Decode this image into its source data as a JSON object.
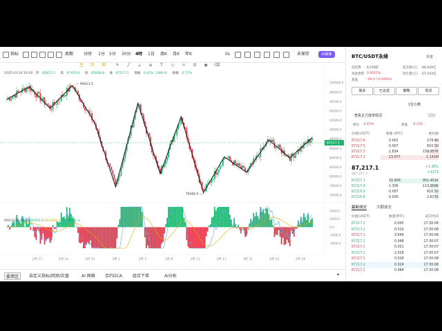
{
  "toolbar": {
    "icon_label": "指标",
    "chart_settings": "图表",
    "interval_group": "周期",
    "intervals": [
      "分时",
      "1分",
      "5分",
      "30分",
      "4时",
      "1日",
      "周K",
      "月K",
      "年K"
    ],
    "active_interval": "4时",
    "settings_label": "0s",
    "mode_label": "未保存",
    "ai_label": "AI解读"
  },
  "drawtools": [
    "主",
    "大",
    "测"
  ],
  "info": {
    "date": "2025-03-24 16:00",
    "open_label": "开",
    "open": "85827.5",
    "high_label": "高",
    "high": "87476.4",
    "low_label": "低",
    "low": "85908.8",
    "close_label": "收",
    "close": "87217.1",
    "change_label": "涨幅",
    "change": "0.45%",
    "change2": "(389.0)",
    "amp_label": "振幅",
    "amp": "6.77%"
  },
  "macd": {
    "label": "MACD(12,26,9)",
    "dif_label": "DIF",
    "dif": "693.9",
    "dea_label": "DEA",
    "dea": "360.2",
    "macd_label": "MACD",
    "macd": "611.4"
  },
  "chart_data": {
    "type": "candlestick",
    "symbol": "BTC/USDT",
    "interval": "4h",
    "price_axis_ticks": [
      "100000.0",
      "98000.0",
      "96000.0",
      "94000.0",
      "92000.0",
      "90000.0",
      "88000.0",
      "86000.0",
      "84000.0",
      "82000.0",
      "80000.0",
      "78000.0",
      "76000.0"
    ],
    "price_range": [
      75000,
      101500
    ],
    "last_price_tag": "87217.1",
    "x_ticks": [
      "2月 17",
      "2月 21",
      "2月 25",
      "3月 1",
      "3月 5",
      "3月 9",
      "3月 13",
      "3月 17",
      "3月 21",
      "3月 25",
      "3月 29"
    ],
    "high_label": "99431.5",
    "low_label": "76560.0",
    "zigzag_prices": [
      96500,
      99200,
      94600,
      99431.5,
      91500,
      77800,
      95700,
      80600,
      92800,
      76560,
      84200,
      80900,
      87800,
      84000,
      88300
    ],
    "macd_axis_ticks": [
      "2000.0",
      "1000.0",
      "0.0",
      "-1000.0",
      "-2000.0"
    ],
    "macd_range": [
      -2600,
      2500
    ]
  },
  "bottombar": [
    "委单区",
    "自定义指标/回测/实盘",
    "AI 网格",
    "合约DCA",
    "组合下单",
    "AI分析"
  ],
  "panel": {
    "title": "BTC/USDT永续",
    "exchange": "币安",
    "rows": [
      {
        "l": "前结算",
        "v": "6小时前",
        "l2": "成交额(亿)",
        "v2": "66.839亿"
      },
      {
        "l": "资金费率",
        "v": "0.0015%",
        "l2": "持仓量(亿)",
        "v2": "67.193亿"
      },
      {
        "l": "基差",
        "v": "-40.4 (-0.046%)",
        "l2": "",
        "v2": ""
      }
    ],
    "buttons": [
      "做多",
      "已合选",
      "策略",
      "现货"
    ],
    "depth_tab": "1位小数",
    "note": "查看主力挂单情况",
    "ratio_label": "委比",
    "ratio": "-0.15%",
    "diff_label": "委差",
    "diff": "-6.316",
    "ob_headers": [
      "价格(USDT)",
      "数量 (BTC)",
      "委托额"
    ],
    "asks": [
      {
        "p": "87217.6",
        "q": "0.002",
        "t": "174.40"
      },
      {
        "p": "87217.5",
        "q": "0.007",
        "t": "610.50"
      },
      {
        "p": "87217.3",
        "q": "1.834",
        "t": "159.957K"
      },
      {
        "p": "87217.2",
        "q": "13.077",
        "t": "1.141M"
      }
    ],
    "mid_price": "87,217.1",
    "mid_sub": "$87,217.1",
    "mid_change": "+1.36%",
    "mid_change2": "+1173",
    "bids": [
      {
        "p": "87217.1",
        "q": "10.909",
        "t": "951.451K"
      },
      {
        "p": "87217.0",
        "q": "1.306",
        "t": "113.909K"
      },
      {
        "p": "87216.9",
        "q": "0.007",
        "t": "610.50"
      },
      {
        "p": "87216.8",
        "q": "0.030",
        "t": "2.617K"
      }
    ],
    "trade_tabs": [
      "最新成交",
      "大额成交"
    ],
    "tr_headers": [
      "价格(USDT)",
      "数量(BTC)",
      "成交时间"
    ],
    "trades": [
      {
        "p": "87217.2",
        "q": "0.005",
        "t": "17:30:06",
        "c": "g"
      },
      {
        "p": "87217.2",
        "q": "0.510",
        "t": "17:30:06",
        "c": "g"
      },
      {
        "p": "87217.1",
        "q": "3.649",
        "t": "17:30:06",
        "c": "r"
      },
      {
        "p": "87217.2",
        "q": "0.048",
        "t": "17:30:07",
        "c": "g"
      },
      {
        "p": "87217.1",
        "q": "0.021",
        "t": "17:30:07",
        "c": "r"
      },
      {
        "p": "87217.2",
        "q": "2.016",
        "t": "17:30:07",
        "c": "g"
      },
      {
        "p": "87217.1",
        "q": "0.018",
        "t": "17:30:08",
        "c": "r"
      },
      {
        "p": "87217.2",
        "q": "0.024",
        "t": "17:30:08",
        "c": "g"
      },
      {
        "p": "87217.1",
        "q": "0.084",
        "t": "17:30:08",
        "c": "r"
      }
    ]
  },
  "colors": {
    "up": "#1fb26e",
    "down": "#e0364a",
    "accent": "#7a5af8"
  }
}
